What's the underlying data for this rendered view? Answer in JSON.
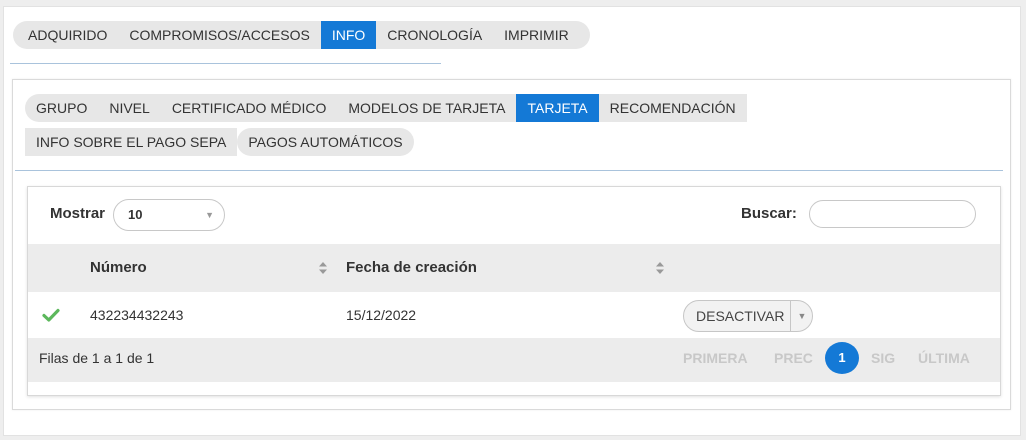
{
  "top_tabs": [
    {
      "label": "ADQUIRIDO",
      "active": false
    },
    {
      "label": "COMPROMISOS/ACCESOS",
      "active": false
    },
    {
      "label": "INFO",
      "active": true
    },
    {
      "label": "CRONOLOGÍA",
      "active": false
    },
    {
      "label": "IMPRIMIR",
      "active": false
    }
  ],
  "sub_tabs": [
    {
      "label": "GRUPO",
      "active": false
    },
    {
      "label": "NIVEL",
      "active": false
    },
    {
      "label": "CERTIFICADO MÉDICO",
      "active": false
    },
    {
      "label": "MODELOS DE TARJETA",
      "active": false
    },
    {
      "label": "TARJETA",
      "active": true
    },
    {
      "label": "RECOMENDACIÓN",
      "active": false
    },
    {
      "label": "INFO SOBRE EL PAGO SEPA",
      "active": false
    },
    {
      "label": "PAGOS AUTOMÁTICOS",
      "active": false
    }
  ],
  "table_controls": {
    "show_label": "Mostrar",
    "show_value": "10",
    "search_label": "Buscar:",
    "search_value": ""
  },
  "table": {
    "columns": [
      "Número",
      "Fecha de creación"
    ],
    "rows": [
      {
        "status_icon": "check-icon",
        "number": "432234432243",
        "created": "15/12/2022",
        "action": "DESACTIVAR"
      }
    ]
  },
  "footer": {
    "info": "Filas de 1 a 1 de 1",
    "first": "PRIMERA",
    "prev": "PREC",
    "current_page": "1",
    "next": "SIG",
    "last": "ÚLTIMA"
  },
  "colors": {
    "accent": "#1479d6",
    "check": "#5cb85c"
  }
}
